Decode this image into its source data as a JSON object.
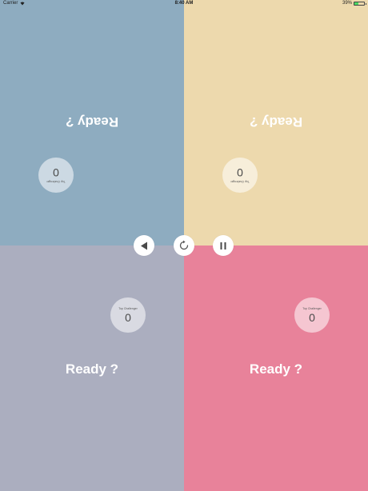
{
  "status_bar": {
    "carrier": "Carrier",
    "time": "8:40 AM",
    "battery": "39%",
    "battery_level": 0.39
  },
  "players": [
    {
      "id": "top-left",
      "prompt": "Ready ?",
      "score": "0",
      "score_label": "Top Challenger",
      "flipped": true,
      "color": "#8eacc0"
    },
    {
      "id": "top-right",
      "prompt": "Ready ?",
      "score": "0",
      "score_label": "Top Challenger",
      "flipped": true,
      "color": "#edd9ad"
    },
    {
      "id": "bottom-left",
      "prompt": "Ready ?",
      "score": "0",
      "score_label": "Top Challenger",
      "flipped": false,
      "color": "#abaebf"
    },
    {
      "id": "bottom-right",
      "prompt": "Ready ?",
      "score": "0",
      "score_label": "Top Challenger",
      "flipped": false,
      "color": "#e8829a"
    }
  ],
  "controls": {
    "back_icon": "play-back-icon",
    "reset_icon": "refresh-icon",
    "pause_icon": "pause-icon"
  }
}
